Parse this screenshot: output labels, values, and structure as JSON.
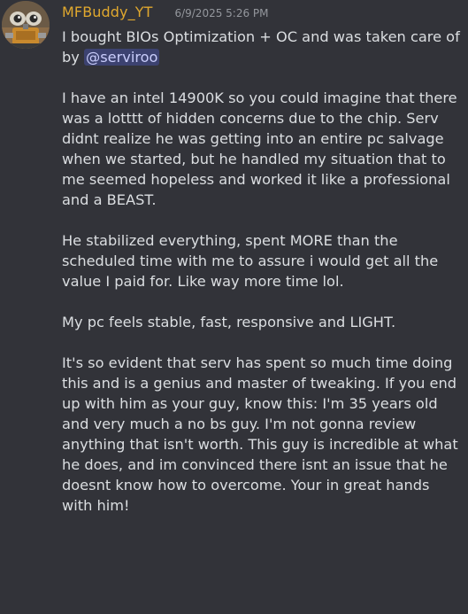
{
  "message": {
    "username": "MFBuddy_YT",
    "timestamp": "6/9/2025 5:26 PM",
    "username_color": "#e0a82e",
    "avatar_icon": "wall-e-robot-avatar",
    "paragraphs": [
      {
        "before": "I bought BIOs Optimization + OC and was taken care of by ",
        "mention": "@serviroo"
      },
      {
        "text": "I have an intel 14900K so you could imagine that there was a lotttt of hidden concerns due to the chip. Serv didnt realize he was getting into an entire pc salvage when we started, but he handled my situation that to me seemed hopeless and worked it like a professional and a BEAST."
      },
      {
        "text": "He stabilized everything, spent MORE than the scheduled time with me to assure i would get all the value I paid for. Like way more time lol."
      },
      {
        "text": "My pc feels stable, fast, responsive and LIGHT."
      },
      {
        "text": "It's so evident that serv has spent so much time doing this and is a genius and master of tweaking. If you end up with him as your guy, know this: I'm 35 years old and very much a no bs guy. I'm not gonna review anything that isn't worth. This guy is incredible at what he does, and im convinced there isnt an issue that he doesnt know how to overcome. Your in great hands with him!"
      }
    ]
  }
}
